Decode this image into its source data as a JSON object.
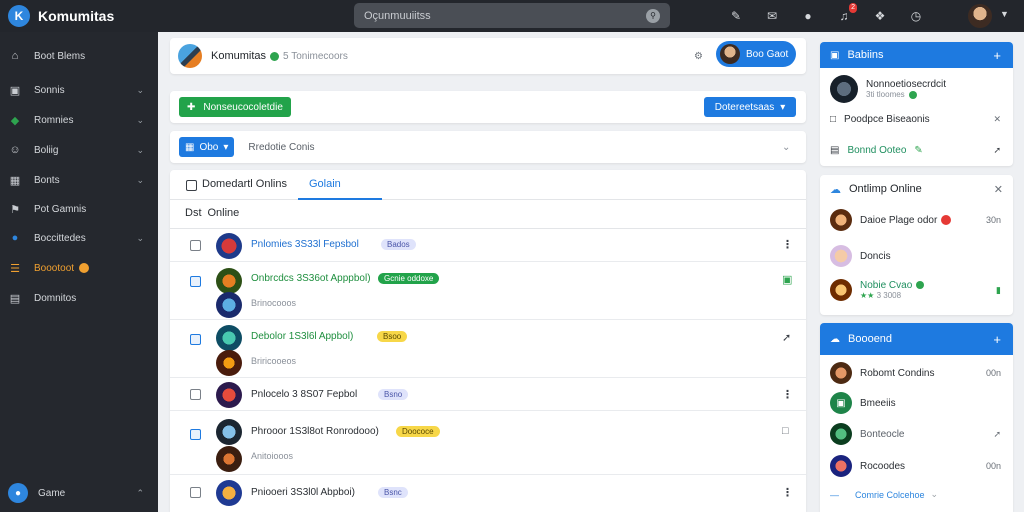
{
  "app": {
    "name": "Komumitas",
    "logo_letter": "K"
  },
  "search": {
    "text": "Oçunmuuiitss"
  },
  "topbar": {
    "notif_count": "2"
  },
  "sidebar": {
    "items": [
      {
        "label": "Boot Blems",
        "icon": "home-icon",
        "chevron": false
      },
      {
        "label": "Sonnis",
        "icon": "image-icon",
        "chevron": true
      },
      {
        "label": "Romnies",
        "icon": "gamepad-icon",
        "chevron": true
      },
      {
        "label": "Boliig",
        "icon": "users-icon",
        "chevron": true
      },
      {
        "label": "Bonts",
        "icon": "calendar-icon",
        "chevron": true
      },
      {
        "label": "Pot Gamnis",
        "icon": "tag-icon",
        "chevron": false
      },
      {
        "label": "Boccittedes",
        "icon": "circle-icon",
        "chevron": true
      },
      {
        "label": "Boootoot",
        "icon": "bookmark-icon",
        "chevron": false
      },
      {
        "label": "Domnitos",
        "icon": "doc-icon",
        "chevron": false
      }
    ],
    "active_index": 7,
    "bottom_label": "Game"
  },
  "header": {
    "community_name": "Komumitas",
    "meta": "5  Tonimecoors",
    "join_label": "Boo Gaot"
  },
  "actions": {
    "primary_label": "Nonseucocoletdie",
    "secondary_label": "Dotereetsaas"
  },
  "filter": {
    "button_label": "Obo",
    "label": "Rredotie Conis"
  },
  "tabs": {
    "check_label": "Domedartl Onlins",
    "active_label": "Golain"
  },
  "dist": {
    "prefix": "Dst",
    "label": "Online"
  },
  "rows": [
    {
      "title": "Pnlomies 3S33l Fepsbol",
      "tag": "Bados",
      "tag_style": "lav",
      "sub": "",
      "style": "blue"
    },
    {
      "title": "Onbrcdcs 3S36ot Apppbol)",
      "tag": "Gcnie oddoxe",
      "tag_style": "green",
      "sub": "Brinocooos",
      "style": "green"
    },
    {
      "title": "Debolor 1S3l6l Appbol)",
      "tag": "Bsoo",
      "tag_style": "yellow",
      "sub": "Briricooeos",
      "style": "green"
    },
    {
      "title": "Pnlocelo 3 8S07 Fepbol",
      "tag": "Bsno",
      "tag_style": "lav",
      "sub": "",
      "style": "blue"
    },
    {
      "title": "Phrooor 1S3l8ot Ronrodooo)",
      "tag": "Doococe",
      "tag_style": "yellow",
      "sub": "Anitoiooos",
      "style": "mixed"
    },
    {
      "title": "Pniooeri 3S3l0l Abpboi)",
      "tag": "Bsnc",
      "tag_style": "lav",
      "sub": "",
      "style": "blue"
    }
  ],
  "panel_a": {
    "title": "Babiins",
    "item1_name": "Nonnoetiosecrdcit",
    "item1_sub": "3ti tloomes",
    "item2_name": "Poodpce Biseaonis",
    "item3_name": "Bonnd Ooteo"
  },
  "panel_b": {
    "title": "Ontlimp Online",
    "items": [
      {
        "name": "Daioe Plage odor",
        "time": "30n"
      },
      {
        "name": "Doncis",
        "time": ""
      },
      {
        "name": "Nobie Cvao",
        "time": "",
        "sub": "3 3008"
      }
    ]
  },
  "panel_c": {
    "title": "Boooend",
    "items": [
      {
        "name": "Robomt Condins",
        "time": "00n"
      },
      {
        "name": "Bmeeiis",
        "time": ""
      },
      {
        "name": "Bonteocle",
        "time": ""
      },
      {
        "name": "Rocoodes",
        "time": "00n"
      }
    ],
    "footer": "Comrie Colcehoe"
  }
}
